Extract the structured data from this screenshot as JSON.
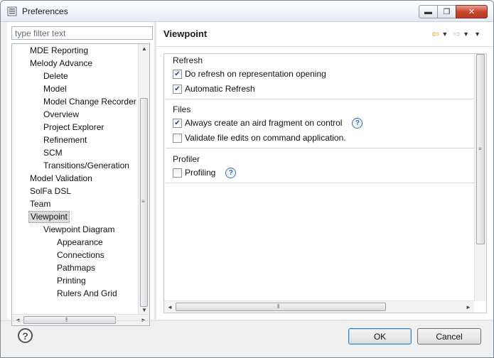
{
  "window": {
    "title": "Preferences",
    "minimize_glyph": "▬",
    "maximize_glyph": "❐",
    "close_glyph": "✕"
  },
  "filter": {
    "placeholder": "type filter text",
    "value": ""
  },
  "tree": {
    "items": [
      {
        "label": "MDE Reporting",
        "level": 1,
        "selected": false
      },
      {
        "label": "Melody Advance",
        "level": 1,
        "selected": false
      },
      {
        "label": "Delete",
        "level": 2,
        "selected": false
      },
      {
        "label": "Model",
        "level": 2,
        "selected": false
      },
      {
        "label": "Model Change Recorder",
        "level": 2,
        "selected": false
      },
      {
        "label": "Overview",
        "level": 2,
        "selected": false
      },
      {
        "label": "Project Explorer",
        "level": 2,
        "selected": false
      },
      {
        "label": "Refinement",
        "level": 2,
        "selected": false
      },
      {
        "label": "SCM",
        "level": 2,
        "selected": false
      },
      {
        "label": "Transitions/Generation",
        "level": 2,
        "selected": false
      },
      {
        "label": "Model Validation",
        "level": 1,
        "selected": false
      },
      {
        "label": "SolFa DSL",
        "level": 1,
        "selected": false
      },
      {
        "label": "Team",
        "level": 1,
        "selected": false
      },
      {
        "label": "Viewpoint",
        "level": 1,
        "selected": true
      },
      {
        "label": "Viewpoint Diagram",
        "level": 2,
        "selected": false
      },
      {
        "label": "Appearance",
        "level": 3,
        "selected": false
      },
      {
        "label": "Connections",
        "level": 3,
        "selected": false
      },
      {
        "label": "Pathmaps",
        "level": 3,
        "selected": false
      },
      {
        "label": "Printing",
        "level": 3,
        "selected": false
      },
      {
        "label": "Rulers And Grid",
        "level": 3,
        "selected": false
      }
    ]
  },
  "page": {
    "title": "Viewpoint",
    "nav_back_glyph": "⇦",
    "nav_forward_glyph": "⇨",
    "dropdown_glyph": "▼",
    "sections": [
      {
        "title": "Refresh",
        "options": [
          {
            "label": "Do refresh on representation opening",
            "checked": true,
            "help": false
          },
          {
            "label": "Automatic Refresh",
            "checked": true,
            "help": false
          }
        ]
      },
      {
        "title": "Files",
        "options": [
          {
            "label": "Always create an aird fragment on control",
            "checked": true,
            "help": true
          },
          {
            "label": "Validate file edits on command application.",
            "checked": false,
            "help": false
          }
        ]
      },
      {
        "title": "Profiler",
        "options": [
          {
            "label": "Profiling",
            "checked": false,
            "help": true
          }
        ]
      }
    ]
  },
  "scroll": {
    "up": "▲",
    "down": "▼",
    "left": "◄",
    "right": "►",
    "grip_v": "≡",
    "grip_h": "⦀"
  },
  "footer": {
    "help_glyph": "?",
    "ok_label": "OK",
    "cancel_label": "Cancel"
  }
}
